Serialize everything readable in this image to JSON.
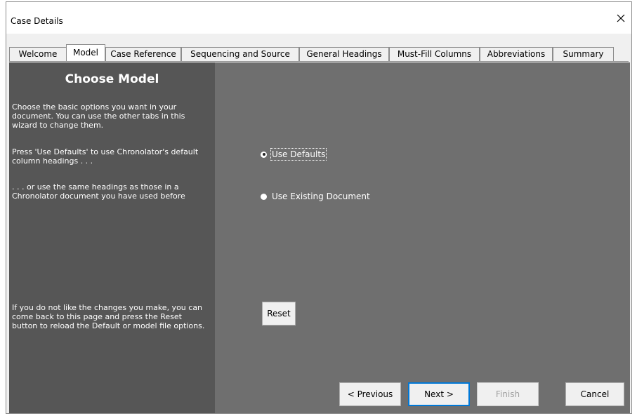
{
  "window": {
    "title": "Case Details",
    "close_icon": "close-icon"
  },
  "tabs": [
    {
      "label": "Welcome",
      "active": false
    },
    {
      "label": "Model",
      "active": true
    },
    {
      "label": "Case Reference",
      "active": false
    },
    {
      "label": "Sequencing and Source",
      "active": false
    },
    {
      "label": "General Headings",
      "active": false
    },
    {
      "label": "Must-Fill Columns",
      "active": false
    },
    {
      "label": "Abbreviations",
      "active": false
    },
    {
      "label": "Summary",
      "active": false
    }
  ],
  "left_panel": {
    "title": "Choose Model",
    "para1": "Choose the basic options you want in your document. You can use the other tabs in this wizard to change them.",
    "para2": "Press 'Use Defaults' to use Chronolator's default column headings . . .",
    "para3": ". . . or use the same headings as those in a Chronolator  document you have used before",
    "para4": "If you do not like the changes you make, you can come back to this page and press the Reset button to reload the Default or model file options."
  },
  "options": {
    "use_defaults": {
      "label": "Use Defaults",
      "checked": true
    },
    "use_existing": {
      "label": "Use Existing Document",
      "checked": false
    }
  },
  "buttons": {
    "reset": "Reset",
    "previous": "< Previous",
    "next": "Next >",
    "finish": "Finish",
    "cancel": "Cancel"
  },
  "colors": {
    "panel_dark": "#565656",
    "panel_mid": "#6f6f6f",
    "accent_focus": "#0078d7"
  }
}
